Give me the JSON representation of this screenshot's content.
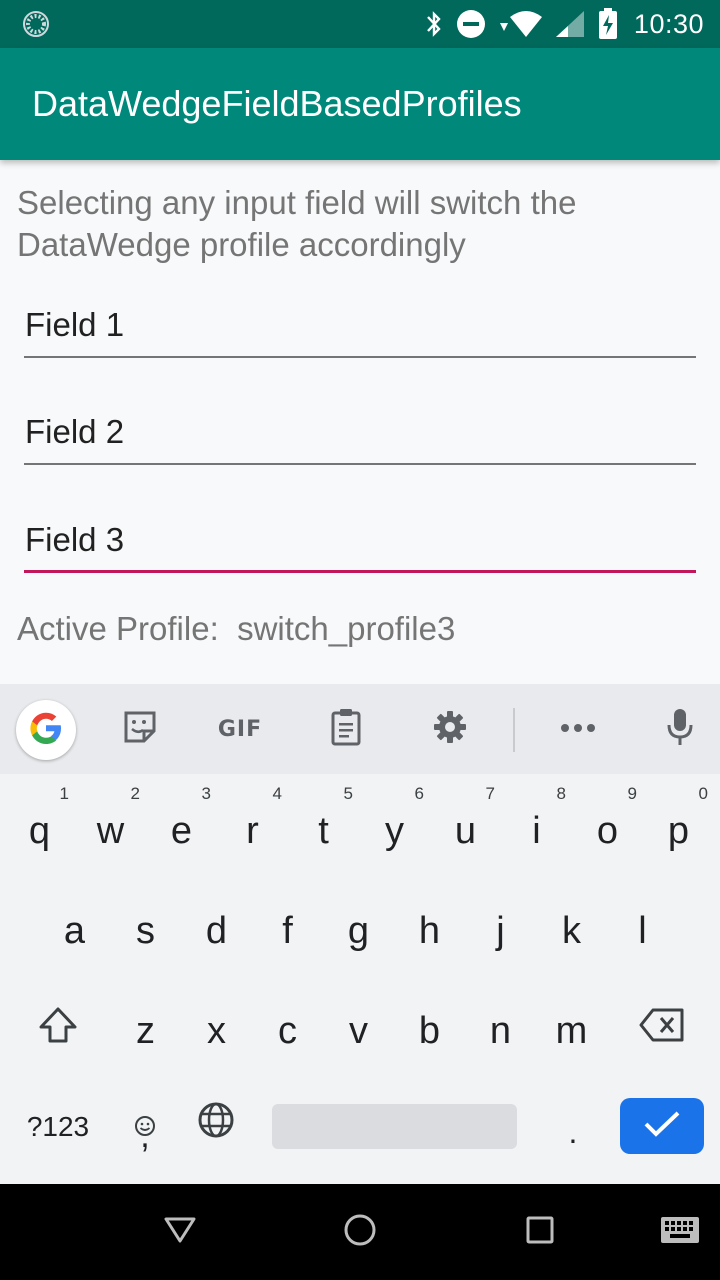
{
  "status_bar": {
    "time": "10:30",
    "icons": [
      "sync-status-icon",
      "bluetooth-icon",
      "do-not-disturb-icon",
      "wifi-icon",
      "cell-signal-icon",
      "battery-charging-icon"
    ]
  },
  "app_bar": {
    "title": "DataWedgeFieldBasedProfiles",
    "color": "#00897b"
  },
  "content": {
    "instructions": "Selecting any input field will switch the DataWedge profile accordingly",
    "fields": [
      {
        "value": "Field 1",
        "focused": false
      },
      {
        "value": "Field 2",
        "focused": false
      },
      {
        "value": "Field 3",
        "focused": true
      }
    ],
    "active_profile": "Active Profile:  switch_profile3",
    "focus_color": "#c2185b"
  },
  "keyboard": {
    "toolbar": {
      "gif_label": "GIF",
      "icons": [
        "google-icon",
        "sticker-icon",
        "gif-icon",
        "clipboard-icon",
        "settings-gear-icon",
        "more-icon",
        "microphone-icon"
      ]
    },
    "row1": [
      {
        "key": "q",
        "hint": "1"
      },
      {
        "key": "w",
        "hint": "2"
      },
      {
        "key": "e",
        "hint": "3"
      },
      {
        "key": "r",
        "hint": "4"
      },
      {
        "key": "t",
        "hint": "5"
      },
      {
        "key": "y",
        "hint": "6"
      },
      {
        "key": "u",
        "hint": "7"
      },
      {
        "key": "i",
        "hint": "8"
      },
      {
        "key": "o",
        "hint": "9"
      },
      {
        "key": "p",
        "hint": "0"
      }
    ],
    "row2": [
      "a",
      "s",
      "d",
      "f",
      "g",
      "h",
      "j",
      "k",
      "l"
    ],
    "row3": [
      "z",
      "x",
      "c",
      "v",
      "b",
      "n",
      "m"
    ],
    "bottom": {
      "symbols_label": "?123",
      "comma": ",",
      "period": ".",
      "enter_color": "#1a73e8"
    }
  },
  "nav_bar": {
    "icons": [
      "back-icon",
      "home-icon",
      "recents-icon",
      "keyboard-switch-icon"
    ]
  }
}
